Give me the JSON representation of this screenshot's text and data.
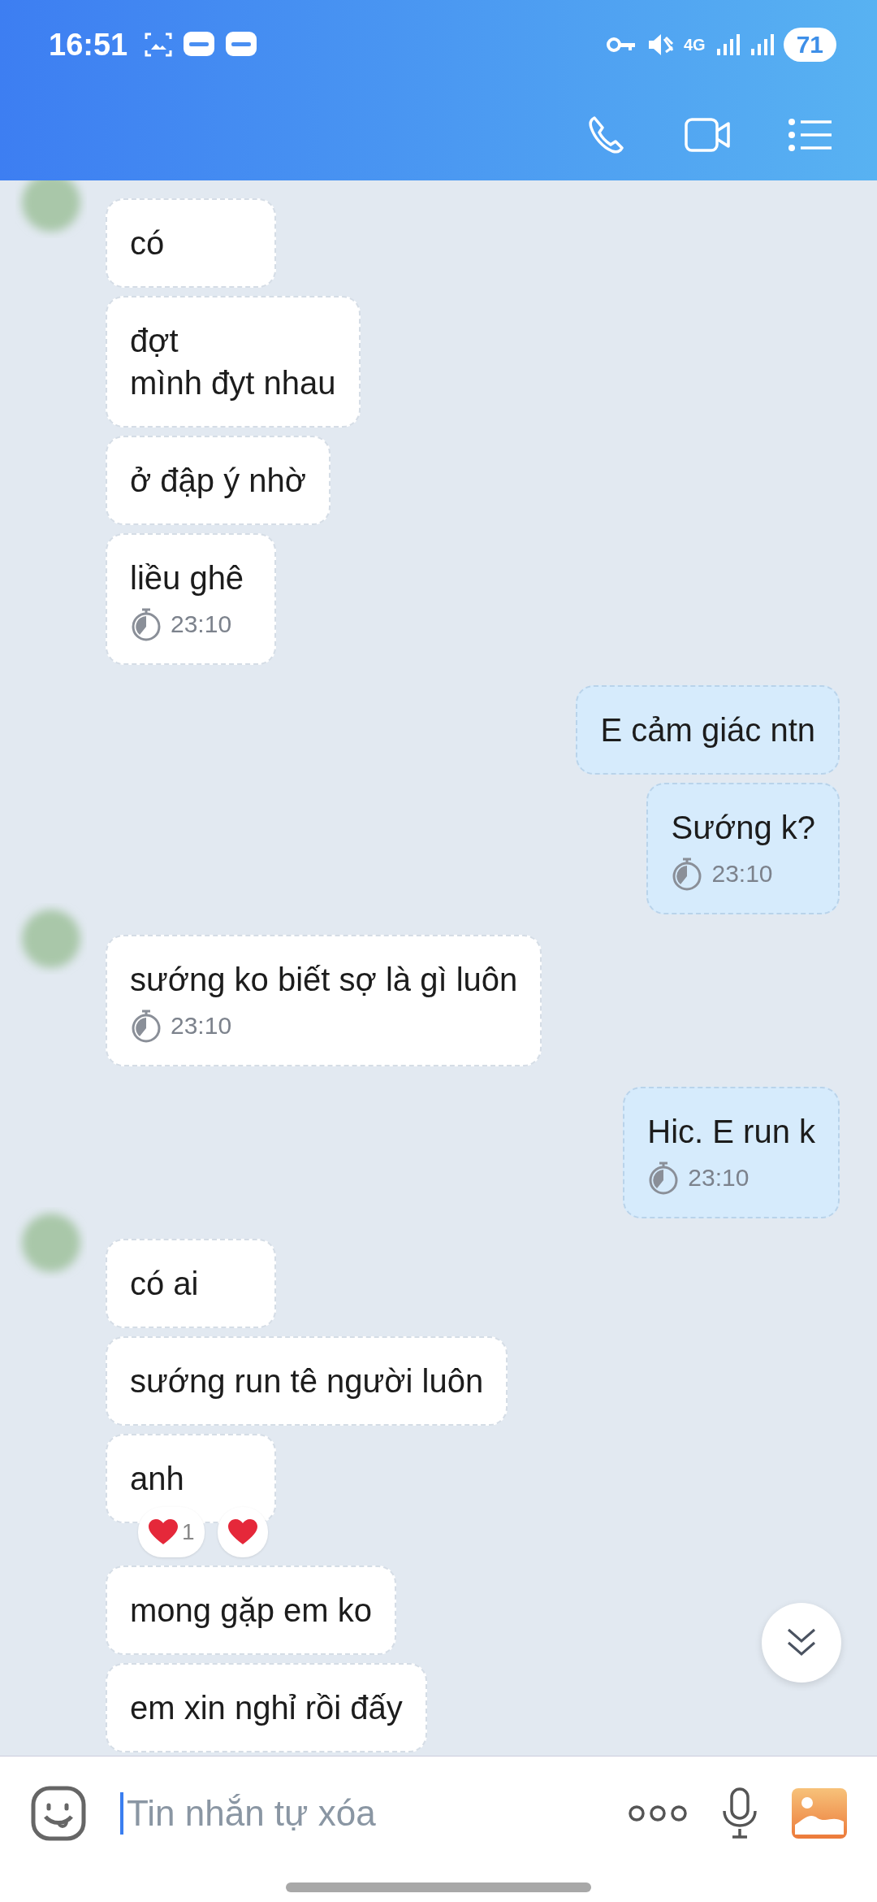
{
  "status_bar": {
    "time": "16:51",
    "network": "4G",
    "battery": "71"
  },
  "messages": [
    {
      "kind": "received",
      "avatar": true,
      "text": "có"
    },
    {
      "kind": "received",
      "avatar": false,
      "text": "đợt\nmình đyt nhau"
    },
    {
      "kind": "received",
      "avatar": false,
      "text": "ở đập ý nhờ"
    },
    {
      "kind": "received",
      "avatar": false,
      "text": "liều ghê",
      "time": "23:10"
    },
    {
      "kind": "sent",
      "avatar": false,
      "text": "E cảm giác ntn"
    },
    {
      "kind": "sent",
      "avatar": false,
      "text": "Sướng k?",
      "time": "23:10"
    },
    {
      "kind": "received",
      "avatar": true,
      "text": "sướng ko biết sợ là gì luôn",
      "time": "23:10"
    },
    {
      "kind": "sent",
      "avatar": false,
      "text": "Hic. E run k",
      "time": "23:10"
    },
    {
      "kind": "received",
      "avatar": true,
      "text": "có ai"
    },
    {
      "kind": "received",
      "avatar": false,
      "text": "sướng run tê người luôn"
    },
    {
      "kind": "received",
      "avatar": false,
      "text": "anh",
      "reactions": [
        {
          "kind": "heart",
          "count": "1"
        },
        {
          "kind": "heart"
        }
      ]
    },
    {
      "kind": "received",
      "avatar": false,
      "text": "mong gặp em ko"
    },
    {
      "kind": "received",
      "avatar": false,
      "text": "em xin nghỉ rồi đấy"
    }
  ],
  "composer": {
    "placeholder": "Tin nhắn tự xóa"
  }
}
